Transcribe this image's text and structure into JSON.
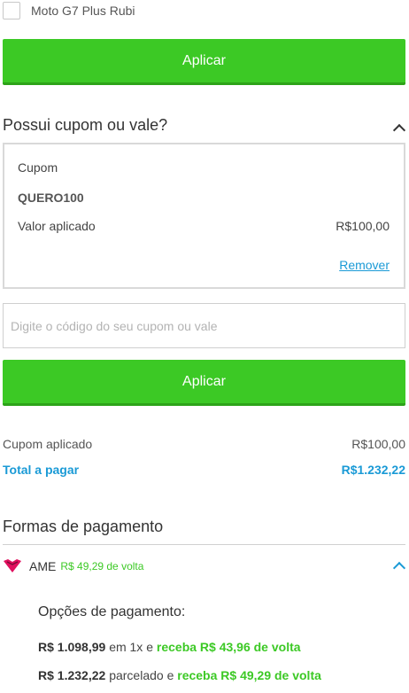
{
  "product_option": {
    "label": "Moto G7 Plus Rubi",
    "checked": false
  },
  "apply_button_top": {
    "label": "Aplicar"
  },
  "coupon_section": {
    "title": "Possui cupom ou vale?",
    "expanded": true,
    "applied_coupon": {
      "label": "Cupom",
      "code": "QUERO100",
      "value_label": "Valor aplicado",
      "value": "R$100,00",
      "remove_label": "Remover"
    },
    "input": {
      "placeholder": "Digite o código do seu cupom ou vale",
      "value": ""
    },
    "apply_label": "Aplicar"
  },
  "summary": {
    "applied_label": "Cupom aplicado",
    "applied_value": "R$100,00",
    "total_label": "Total a pagar",
    "total_value": "R$1.232,22"
  },
  "payment": {
    "title": "Formas de pagamento",
    "method": {
      "name": "AME",
      "cashback": "R$ 49,29 de volta",
      "icon": "ame-heart-icon",
      "expanded": true
    },
    "options_title": "Opções de pagamento:",
    "options": [
      {
        "amount": "R$ 1.098,99",
        "middle": "em 1x e",
        "cashback": "receba R$ 43,96 de volta"
      },
      {
        "amount": "R$ 1.232,22",
        "middle": "parcelado e",
        "cashback": "receba R$ 49,29 de volta"
      }
    ]
  },
  "colors": {
    "green": "#3cc925",
    "blue": "#1a9ad6",
    "ame_pink": "#e0105e"
  }
}
